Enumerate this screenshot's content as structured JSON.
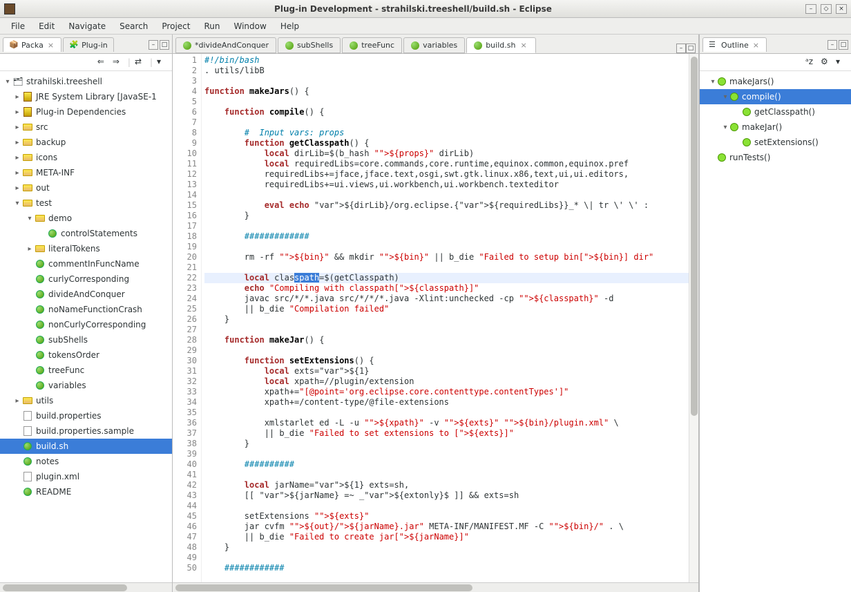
{
  "titlebar": {
    "title": "Plug-in Development - strahilski.treeshell/build.sh - Eclipse"
  },
  "menu": {
    "items": [
      "File",
      "Edit",
      "Navigate",
      "Search",
      "Project",
      "Run",
      "Window",
      "Help"
    ]
  },
  "package_explorer": {
    "tab_label": "Packa",
    "plugin_tab_label": "Plug-in",
    "root": "strahilski.treeshell",
    "items": [
      {
        "label": "JRE System Library [JavaSE-1",
        "depth": 1,
        "exp": "+",
        "icon": "jar"
      },
      {
        "label": "Plug-in Dependencies",
        "depth": 1,
        "exp": "+",
        "icon": "jar"
      },
      {
        "label": "src",
        "depth": 1,
        "exp": "+",
        "icon": "folder"
      },
      {
        "label": "backup",
        "depth": 1,
        "exp": "+",
        "icon": "folder"
      },
      {
        "label": "icons",
        "depth": 1,
        "exp": "+",
        "icon": "folder"
      },
      {
        "label": "META-INF",
        "depth": 1,
        "exp": "+",
        "icon": "folder"
      },
      {
        "label": "out",
        "depth": 1,
        "exp": "+",
        "icon": "folder"
      },
      {
        "label": "test",
        "depth": 1,
        "exp": "-",
        "icon": "folder"
      },
      {
        "label": "demo",
        "depth": 2,
        "exp": "-",
        "icon": "folder"
      },
      {
        "label": "controlStatements",
        "depth": 3,
        "exp": "",
        "icon": "leaf"
      },
      {
        "label": "literalTokens",
        "depth": 2,
        "exp": "+",
        "icon": "folder"
      },
      {
        "label": "commentInFuncName",
        "depth": 2,
        "exp": "",
        "icon": "leaf"
      },
      {
        "label": "curlyCorresponding",
        "depth": 2,
        "exp": "",
        "icon": "leaf"
      },
      {
        "label": "divideAndConquer",
        "depth": 2,
        "exp": "",
        "icon": "leaf"
      },
      {
        "label": "noNameFunctionCrash",
        "depth": 2,
        "exp": "",
        "icon": "leaf"
      },
      {
        "label": "nonCurlyCorresponding",
        "depth": 2,
        "exp": "",
        "icon": "leaf"
      },
      {
        "label": "subShells",
        "depth": 2,
        "exp": "",
        "icon": "leaf"
      },
      {
        "label": "tokensOrder",
        "depth": 2,
        "exp": "",
        "icon": "leaf"
      },
      {
        "label": "treeFunc",
        "depth": 2,
        "exp": "",
        "icon": "leaf"
      },
      {
        "label": "variables",
        "depth": 2,
        "exp": "",
        "icon": "leaf"
      },
      {
        "label": "utils",
        "depth": 1,
        "exp": "+",
        "icon": "folder"
      },
      {
        "label": "build.properties",
        "depth": 1,
        "exp": "",
        "icon": "file"
      },
      {
        "label": "build.properties.sample",
        "depth": 1,
        "exp": "",
        "icon": "file"
      },
      {
        "label": "build.sh",
        "depth": 1,
        "exp": "",
        "icon": "leaf",
        "selected": true
      },
      {
        "label": "notes",
        "depth": 1,
        "exp": "",
        "icon": "leaf"
      },
      {
        "label": "plugin.xml",
        "depth": 1,
        "exp": "",
        "icon": "file"
      },
      {
        "label": "README",
        "depth": 1,
        "exp": "",
        "icon": "leaf"
      }
    ]
  },
  "editor_tabs": [
    {
      "label": "*divideAndConquer",
      "active": false
    },
    {
      "label": "subShells",
      "active": false
    },
    {
      "label": "treeFunc",
      "active": false
    },
    {
      "label": "variables",
      "active": false
    },
    {
      "label": "build.sh",
      "active": true,
      "closable": true
    }
  ],
  "code_lines": {
    "1": "#!/bin/bash",
    "2": ". utils/libB",
    "3": "",
    "4": "function makeJars() {",
    "5": "",
    "6": "    function compile() {",
    "7": "",
    "8": "        #  Input vars: props",
    "9": "        function getClasspath() {",
    "10": "            local dirLib=$(b_hash \"${props}\" dirLib)",
    "11": "            local requiredLibs=core.commands,core.runtime,equinox.common,equinox.pref",
    "12": "            requiredLibs+=jface,jface.text,osgi,swt.gtk.linux.x86,text,ui,ui.editors,",
    "13": "            requiredLibs+=ui.views,ui.workbench,ui.workbench.texteditor",
    "14": "",
    "15": "            eval echo ${dirLib}/org.eclipse.{${requiredLibs}}_* \\| tr \\' \\' :",
    "16": "        }",
    "17": "",
    "18": "        #############",
    "19": "",
    "20": "        rm -rf \"${bin}\" && mkdir \"${bin}\" || b_die \"Failed to setup bin[${bin}] dir\"",
    "21": "",
    "22": "        local classpath=$(getClasspath)",
    "23": "        echo \"Compiling with classpath[${classpath}]\"",
    "24": "        javac src/*/*.java src/*/*/*.java -Xlint:unchecked -cp \"${classpath}\" -d",
    "25": "        || b_die \"Compilation failed\"",
    "26": "    }",
    "27": "",
    "28": "    function makeJar() {",
    "29": "",
    "30": "        function setExtensions() {",
    "31": "            local exts=${1}",
    "32": "            local xpath=//plugin/extension",
    "33": "            xpath+=\"[@point='org.eclipse.core.contenttype.contentTypes']\"",
    "34": "            xpath+=/content-type/@file-extensions",
    "35": "",
    "36": "            xmlstarlet ed -L -u \"${xpath}\" -v \"${exts}\" \"${bin}/plugin.xml\" \\",
    "37": "            || b_die \"Failed to set extensions to [${exts}]\"",
    "38": "        }",
    "39": "",
    "40": "        ##########",
    "41": "",
    "42": "        local jarName=${1} exts=sh,",
    "43": "        [[ ${jarName} =~ _${extonly}$ ]] && exts=sh",
    "44": "",
    "45": "        setExtensions \"${exts}\"",
    "46": "        jar cvfm \"${out}/${jarName}.jar\" META-INF/MANIFEST.MF -C \"${bin}/\" . \\",
    "47": "        || b_die \"Failed to create jar[${jarName}]\"",
    "48": "    }",
    "49": "",
    "50": "    ############"
  },
  "highlighted_line": 22,
  "selection": {
    "line": 22,
    "text": "spath"
  },
  "outline": {
    "tab_label": "Outline",
    "items": [
      {
        "label": "makeJars()",
        "depth": 0,
        "exp": "-"
      },
      {
        "label": "compile()",
        "depth": 1,
        "exp": "-",
        "selected": true
      },
      {
        "label": "getClasspath()",
        "depth": 2,
        "exp": ""
      },
      {
        "label": "makeJar()",
        "depth": 1,
        "exp": "-"
      },
      {
        "label": "setExtensions()",
        "depth": 2,
        "exp": ""
      },
      {
        "label": "runTests()",
        "depth": 0,
        "exp": ""
      }
    ]
  }
}
